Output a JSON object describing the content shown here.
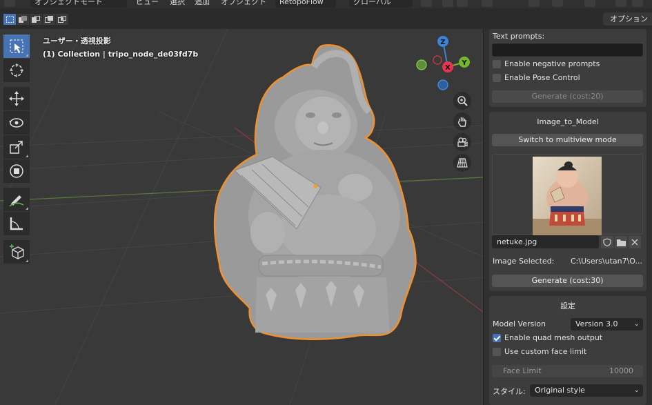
{
  "header": {
    "mode": "オブジェクトモード",
    "menus": [
      "ビュー",
      "選択",
      "追加",
      "オブジェクト"
    ],
    "addon_dropdown": "RetopoFlow",
    "orientation": "グローバル",
    "options_label": "オプション"
  },
  "viewport": {
    "view_label": "ユーザー・透視投影",
    "collection_label": "(1) Collection | tripo_node_de03fd7b",
    "gizmo": {
      "z": "Z",
      "y": "Y",
      "x": "X"
    },
    "tools": [
      "select-box",
      "cursor",
      "move",
      "rotate",
      "scale",
      "transform",
      "annotate",
      "measure",
      "add-cube"
    ],
    "nav": [
      "zoom",
      "pan",
      "camera",
      "perspective-toggle"
    ]
  },
  "text_panel": {
    "prompts_label": "Text prompts:",
    "prompts_value": "",
    "negative_label": "Enable negative prompts",
    "negative_checked": false,
    "pose_label": "Enable Pose Control",
    "pose_checked": false,
    "generate_label": "Generate (cost:20)"
  },
  "image_panel": {
    "title": "Image_to_Model",
    "switch_label": "Switch to multiview mode",
    "filename": "netuke.jpg",
    "selected_label": "Image Selected:",
    "selected_value": "C:\\Users\\utan7\\O...",
    "generate_label": "Generate (cost:30)"
  },
  "settings_panel": {
    "title": "設定",
    "model_version_label": "Model Version",
    "model_version_value": "Version 3.0",
    "quad_label": "Enable quad mesh output",
    "quad_checked": true,
    "face_limit_toggle_label": "Use custom face limit",
    "face_limit_toggle_checked": false,
    "face_limit_label": "Face Limit",
    "face_limit_value": "10000",
    "style_label": "スタイル:",
    "style_value": "Original style"
  },
  "colors": {
    "accent": "#4772b3",
    "outline": "#f0902e",
    "axis_x": "#e8364e",
    "axis_y": "#75b72c",
    "axis_z": "#3c84d6"
  }
}
